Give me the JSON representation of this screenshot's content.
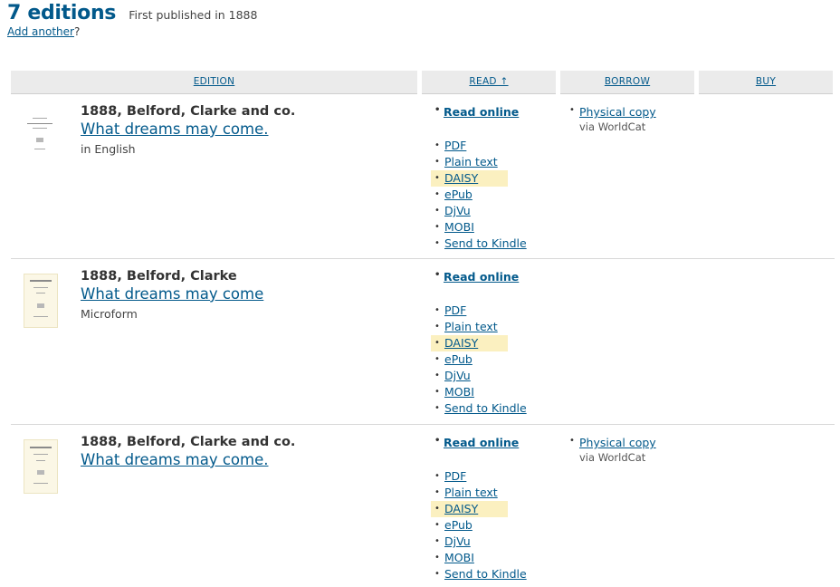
{
  "header": {
    "count": "7 editions",
    "first_published": "First published in 1888",
    "add_link": "Add another",
    "add_suffix": "?"
  },
  "columns": {
    "edition": "EDITION",
    "read": "READ ↑",
    "borrow": "BORROW",
    "buy": "BUY"
  },
  "formats_label_read_online": "Read online",
  "editions": [
    {
      "publisher": "1888, Belford, Clarke and co.",
      "title": "What dreams may come.",
      "extra": "in English",
      "read_online": "Read online",
      "formats": [
        "PDF",
        "Plain text",
        "DAISY",
        "ePub",
        "DjVu",
        "MOBI",
        "Send to Kindle"
      ],
      "borrow": {
        "label": "Physical copy",
        "via": "via WorldCat"
      }
    },
    {
      "publisher": "1888, Belford, Clarke",
      "title": "What dreams may come",
      "extra": "Microform",
      "read_online": "Read online",
      "formats": [
        "PDF",
        "Plain text",
        "DAISY",
        "ePub",
        "DjVu",
        "MOBI",
        "Send to Kindle"
      ]
    },
    {
      "publisher": "1888, Belford, Clarke and co.",
      "title": "What dreams may come.",
      "read_online": "Read online",
      "formats": [
        "PDF",
        "Plain text",
        "DAISY",
        "ePub",
        "DjVu",
        "MOBI",
        "Send to Kindle"
      ],
      "borrow": {
        "label": "Physical copy",
        "via": "via WorldCat"
      }
    }
  ],
  "colors": {
    "link": "#02598b",
    "header_bg": "#ebebeb",
    "highlight": "#fbf0c0",
    "cover_bg": "#fbf7e6"
  }
}
